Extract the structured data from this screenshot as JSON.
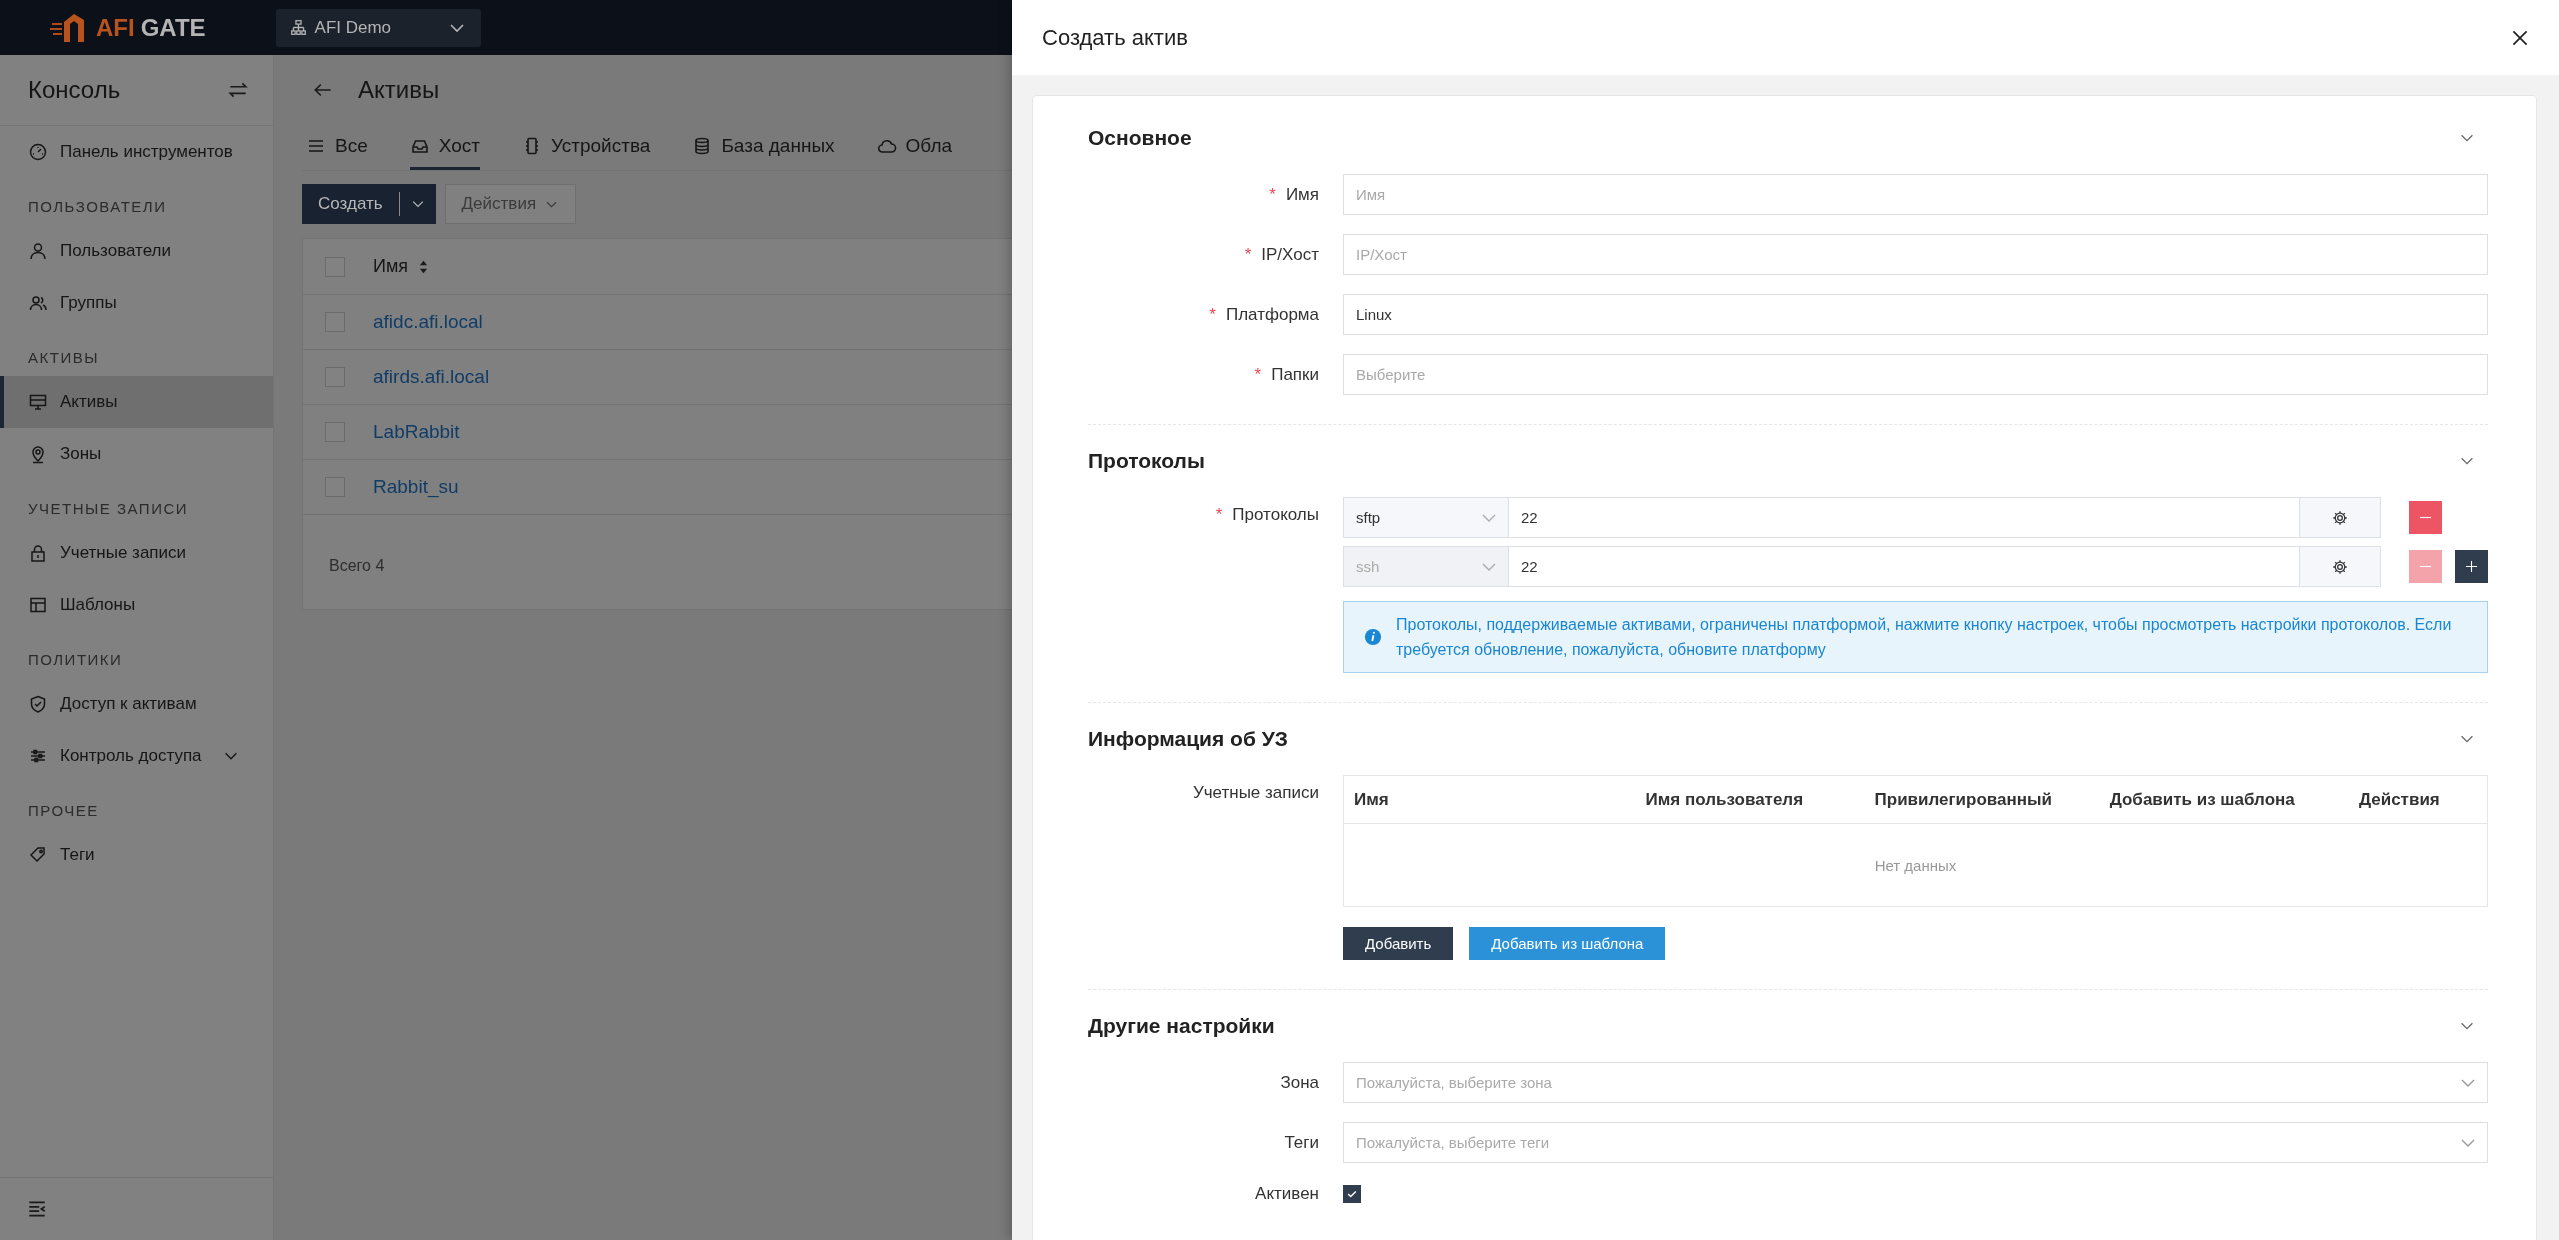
{
  "topbar": {
    "logo_accent": "AFI",
    "logo_rest": "GATE",
    "org_selector": "AFI Demo"
  },
  "sidebar": {
    "title": "Консоль",
    "items": [
      {
        "kind": "item",
        "label": "Панель инструментов",
        "selected": false
      },
      {
        "kind": "heading",
        "label": "ПОЛЬЗОВАТЕЛИ"
      },
      {
        "kind": "item",
        "label": "Пользователи",
        "selected": false
      },
      {
        "kind": "item",
        "label": "Группы",
        "selected": false
      },
      {
        "kind": "heading",
        "label": "АКТИВЫ"
      },
      {
        "kind": "item",
        "label": "Активы",
        "selected": true
      },
      {
        "kind": "item",
        "label": "Зоны",
        "selected": false
      },
      {
        "kind": "heading",
        "label": "УЧЕТНЫЕ ЗАПИСИ"
      },
      {
        "kind": "item",
        "label": "Учетные записи",
        "selected": false
      },
      {
        "kind": "item",
        "label": "Шаблоны",
        "selected": false
      },
      {
        "kind": "heading",
        "label": "ПОЛИТИКИ"
      },
      {
        "kind": "item",
        "label": "Доступ к активам",
        "selected": false
      },
      {
        "kind": "item",
        "label": "Контроль доступа",
        "selected": false,
        "expanded": false
      },
      {
        "kind": "heading",
        "label": "ПРОЧЕЕ"
      },
      {
        "kind": "item",
        "label": "Теги",
        "selected": false
      }
    ]
  },
  "page": {
    "title": "Активы",
    "tabs": [
      {
        "label": "Все",
        "selected": false
      },
      {
        "label": "Хост",
        "selected": true
      },
      {
        "label": "Устройства",
        "selected": false
      },
      {
        "label": "База данных",
        "selected": false
      },
      {
        "label": "Обла",
        "selected": false
      }
    ],
    "create_button": "Создать",
    "actions_button": "Действия",
    "table": {
      "all_checked": false,
      "columns": [
        "Имя"
      ],
      "rows": [
        {
          "name": "afidc.afi.local",
          "checked": false
        },
        {
          "name": "afirds.afi.local",
          "checked": false
        },
        {
          "name": "LabRabbit",
          "checked": false
        },
        {
          "name": "Rabbit_su",
          "checked": false
        }
      ],
      "total": "Всего 4"
    }
  },
  "drawer": {
    "title": "Создать актив",
    "sections": [
      {
        "kind": "fields",
        "title": "Основное",
        "expanded": true,
        "fields": [
          {
            "kind": "input",
            "label": "Имя",
            "required_mark": "*",
            "placeholder": "Имя"
          },
          {
            "kind": "input",
            "label": "IP/Хост",
            "required_mark": "*",
            "placeholder": "IP/Хост"
          },
          {
            "kind": "input",
            "label": "Платформа",
            "required_mark": "*",
            "value": "Linux"
          },
          {
            "kind": "input",
            "label": "Папки",
            "required_mark": "*",
            "placeholder": "Выберите"
          }
        ]
      },
      {
        "kind": "protocols",
        "title": "Протоколы",
        "expanded": true,
        "label": "Протоколы",
        "required_mark": "*",
        "rows": [
          {
            "protocol": "sftp",
            "port": "22",
            "disabled": false,
            "removable": true,
            "addable": false
          },
          {
            "protocol": "ssh",
            "port": "22",
            "disabled": true,
            "removable": false,
            "addable": true
          }
        ],
        "note": "Протоколы, поддерживаемые активами, ограничены платформой, нажмите кнопку настроек, чтобы просмотреть настройки протоколов. Если требуется обновление, пожалуйста, обновите платформу"
      },
      {
        "kind": "accounts",
        "title": "Информация об УЗ",
        "expanded": true,
        "label": "Учетные записи",
        "columns": [
          "Имя",
          "Имя пользователя",
          "Привилегированный",
          "Добавить из шаблона",
          "Действия"
        ],
        "empty": "Нет данных",
        "buttons": [
          {
            "label": "Добавить",
            "kind": "default"
          },
          {
            "label": "Добавить из шаблона",
            "kind": "primary"
          }
        ]
      },
      {
        "kind": "fields",
        "title": "Другие настройки",
        "expanded": true,
        "fields": [
          {
            "kind": "select",
            "label": "Зона",
            "placeholder": "Пожалуйста, выберите зона"
          },
          {
            "kind": "select",
            "label": "Теги",
            "placeholder": "Пожалуйста, выберите теги"
          },
          {
            "kind": "checkbox",
            "label": "Активен",
            "checked": true
          }
        ]
      }
    ]
  }
}
